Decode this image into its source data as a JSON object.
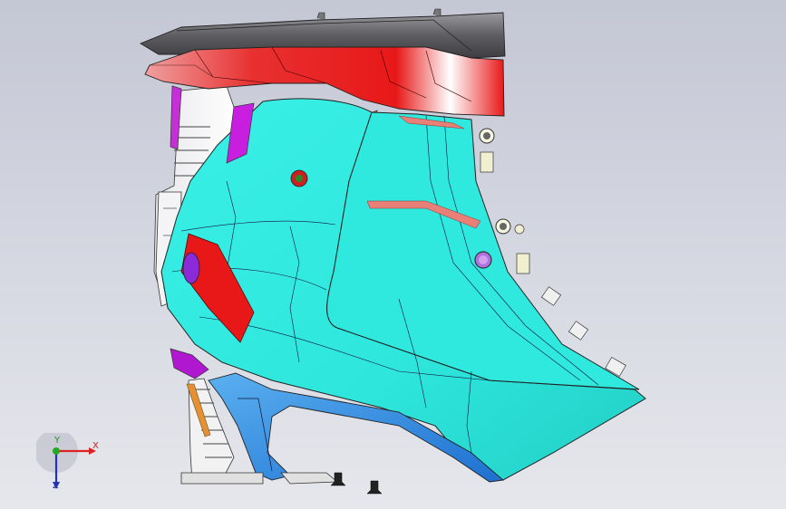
{
  "viewport": {
    "background_top": "#c4c7d4",
    "background_bottom": "#e6e7ec"
  },
  "model": {
    "colors": {
      "panel_cyan": "#2ee6dc",
      "panel_cyan_shadow": "#1fc9c2",
      "trim_red": "#e81818",
      "trim_salmon": "#e88078",
      "trim_dark": "#6a6a6e",
      "bracket_blue": "#2e8ee8",
      "accent_magenta": "#c81ee0",
      "accent_orange": "#e89030",
      "frame_white": "#f2f2f4"
    }
  },
  "triad": {
    "x_label": "X",
    "y_label": "Y",
    "z_label": "Z",
    "x_color": "#dd2222",
    "y_color": "#22aa22",
    "z_color": "#2233bb"
  }
}
